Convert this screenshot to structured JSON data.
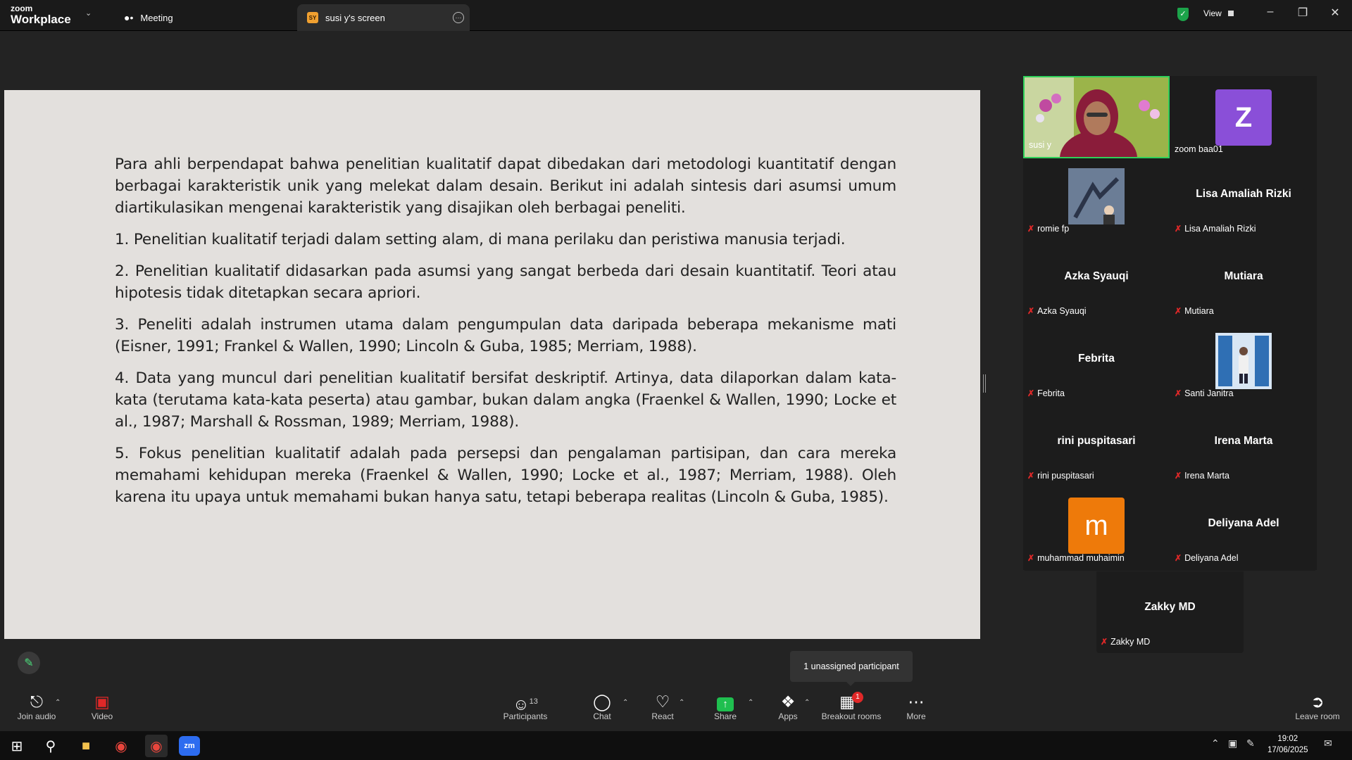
{
  "app": {
    "brand_top": "zoom",
    "brand_bottom": "Workplace"
  },
  "tabs": [
    {
      "label": "Meeting"
    },
    {
      "label": "susi y's screen",
      "badge": "SY"
    }
  ],
  "header": {
    "view_label": "View"
  },
  "slide": {
    "paragraphs": [
      "Para ahli berpendapat bahwa penelitian kualitatif dapat dibedakan dari metodologi kuantitatif dengan berbagai karakteristik unik yang melekat dalam desain. Berikut ini adalah sintesis dari asumsi umum diartikulasikan mengenai karakteristik yang disajikan oleh berbagai peneliti.",
      "1. Penelitian kualitatif terjadi dalam setting alam, di mana perilaku dan peristiwa manusia terjadi.",
      "2. Penelitian kualitatif didasarkan pada asumsi yang sangat berbeda dari desain kuantitatif. Teori atau hipotesis tidak ditetapkan secara apriori.",
      "3. Peneliti adalah instrumen utama dalam pengumpulan data daripada beberapa mekanisme mati (Eisner, 1991; Frankel & Wallen, 1990; Lincoln & Guba, 1985; Merriam, 1988).",
      "4. Data yang muncul dari penelitian kualitatif bersifat deskriptif. Artinya, data dilaporkan dalam kata-kata (terutama kata-kata peserta) atau gambar, bukan dalam angka (Fraenkel & Wallen, 1990; Locke et al., 1987; Marshall & Rossman, 1989; Merriam, 1988).",
      "5. Fokus penelitian kualitatif adalah pada persepsi dan pengalaman partisipan, dan cara mereka memahami kehidupan mereka (Fraenkel & Wallen, 1990; Locke et al., 1987; Merriam, 1988). Oleh karena itu upaya untuk memahami bukan hanya satu, tetapi beberapa realitas (Lincoln & Guba, 1985)."
    ]
  },
  "participants": [
    {
      "name": "susi y"
    },
    {
      "name": "zoom baa01",
      "initial": "Z"
    },
    {
      "name": "romie fp"
    },
    {
      "name": "Lisa Amaliah Rizki"
    },
    {
      "name": "Azka Syauqi"
    },
    {
      "name": "Mutiara"
    },
    {
      "name": "Febrita"
    },
    {
      "name": "Santi Janitra"
    },
    {
      "name": "rini puspitasari"
    },
    {
      "name": "Irena Marta"
    },
    {
      "name": "muhammad muhaimin",
      "initial": "m"
    },
    {
      "name": "Deliyana Adel"
    },
    {
      "name": "Zakky MD"
    }
  ],
  "tooltip": "1 unassigned participant",
  "toolbar": {
    "join_audio": "Join audio",
    "video": "Video",
    "participants": "Participants",
    "participants_count": "13",
    "chat": "Chat",
    "react": "React",
    "share": "Share",
    "apps": "Apps",
    "breakout": "Breakout rooms",
    "breakout_badge": "1",
    "more": "More",
    "leave": "Leave room"
  },
  "taskbar": {
    "time": "19:02",
    "date": "17/06/2025"
  },
  "colors": {
    "accent_green": "#2fd05a",
    "share_green": "#1fbf4f",
    "video_red": "#e02828",
    "zoom_avatar": "#8a4fd8",
    "m_avatar": "#ee7a0a"
  }
}
